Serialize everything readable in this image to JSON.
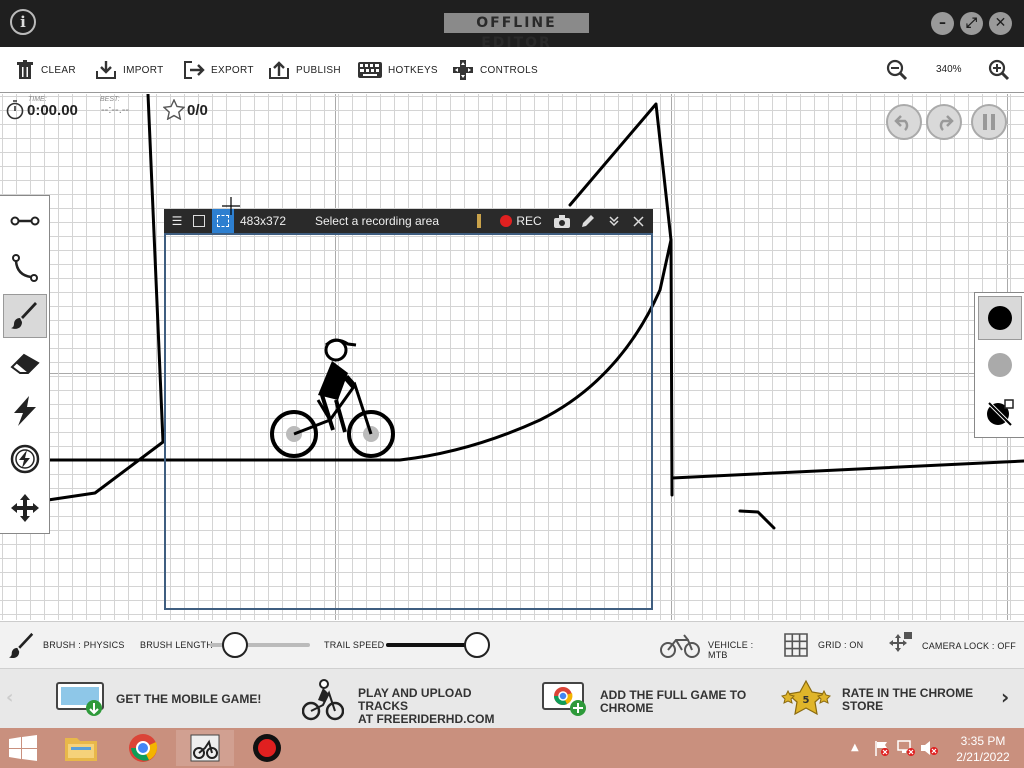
{
  "app": {
    "title": "OFFLINE EDITOR"
  },
  "toolbar": {
    "clear": "CLEAR",
    "import": "IMPORT",
    "export": "EXPORT",
    "publish": "PUBLISH",
    "hotkeys": "HOTKEYS",
    "controls": "CONTROLS",
    "zoom": "340%"
  },
  "timer": {
    "time_label": "TIME:",
    "time": "0:00.00",
    "best_label": "BEST:",
    "best": "--:--.--",
    "stars": "0/0"
  },
  "recorder": {
    "size": "483x372",
    "hint": "Select a recording area",
    "rec": "REC"
  },
  "bottom": {
    "brush": "BRUSH : PHYSICS",
    "brush_length": "BRUSH LENGTH",
    "trail_speed": "TRAIL SPEED",
    "vehicle": "VEHICLE : MTB",
    "grid": "GRID : ON",
    "camera_lock": "CAMERA LOCK : OFF",
    "brush_length_level": 0.16,
    "trail_speed_level": 1.0
  },
  "promo": {
    "mobile": "GET THE MOBILE GAME!",
    "play": "PLAY AND UPLOAD TRACKS\nAT FREERIDERHD.COM",
    "add": "ADD THE FULL GAME TO\nCHROME",
    "rate": "RATE IN THE CHROME\nSTORE",
    "rate_badge": "5"
  },
  "taskbar": {
    "time": "3:35 PM",
    "date": "2/21/2022"
  },
  "colors": {
    "titlebar": "#1f1f1f",
    "canvas_grid": "#d4d4d4",
    "recorder_frame": "#3f5e80",
    "rec_red": "#e02020",
    "taskbar": "#c9907e"
  }
}
